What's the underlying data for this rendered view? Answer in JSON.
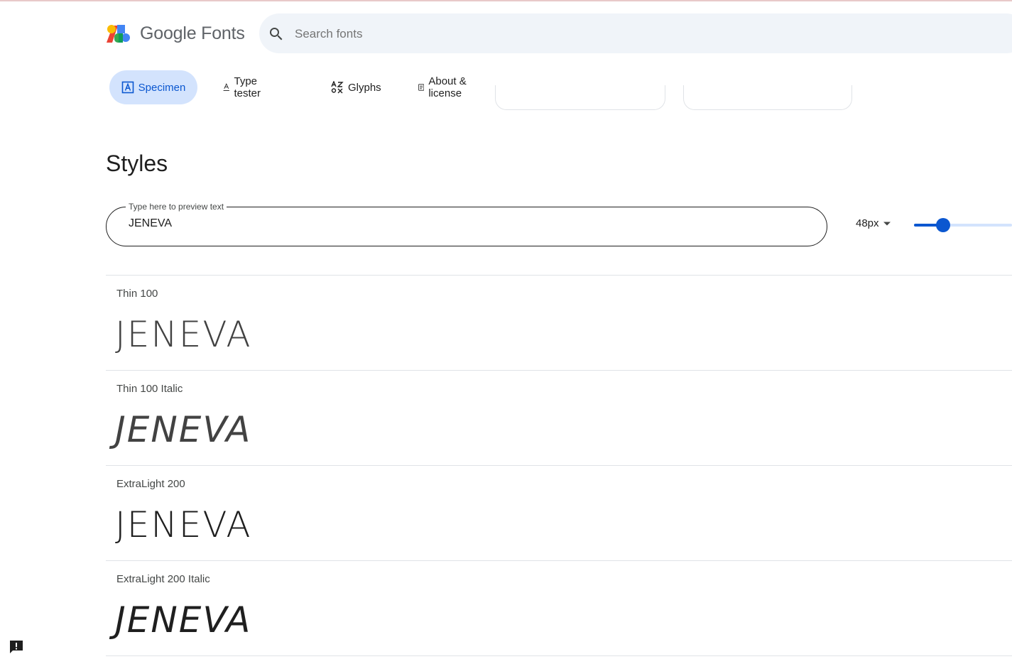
{
  "header": {
    "brand": "Google Fonts",
    "search_placeholder": "Search fonts"
  },
  "tabs": [
    {
      "label": "Specimen",
      "icon": "specimen-icon",
      "active": true
    },
    {
      "label": "Type tester",
      "icon": "type-tester-icon",
      "active": false
    },
    {
      "label": "Glyphs",
      "icon": "glyphs-icon",
      "active": false
    },
    {
      "label": "About & license",
      "icon": "about-icon",
      "active": false
    }
  ],
  "styles": {
    "title": "Styles",
    "preview_label": "Type here to preview text",
    "preview_value": "JENEVA",
    "size": "48px",
    "size_slider_fraction": 0.3,
    "rows": [
      {
        "label": "Thin 100",
        "sample": "JENEVA"
      },
      {
        "label": "Thin 100 Italic",
        "sample": "JENEVA"
      },
      {
        "label": "ExtraLight 200",
        "sample": "JENEVA"
      },
      {
        "label": "ExtraLight 200 Italic",
        "sample": "JENEVA"
      }
    ]
  },
  "colors": {
    "accent": "#0b57d0",
    "tab_active_bg": "#d3e3fd",
    "search_bg": "#f0f4f9"
  }
}
